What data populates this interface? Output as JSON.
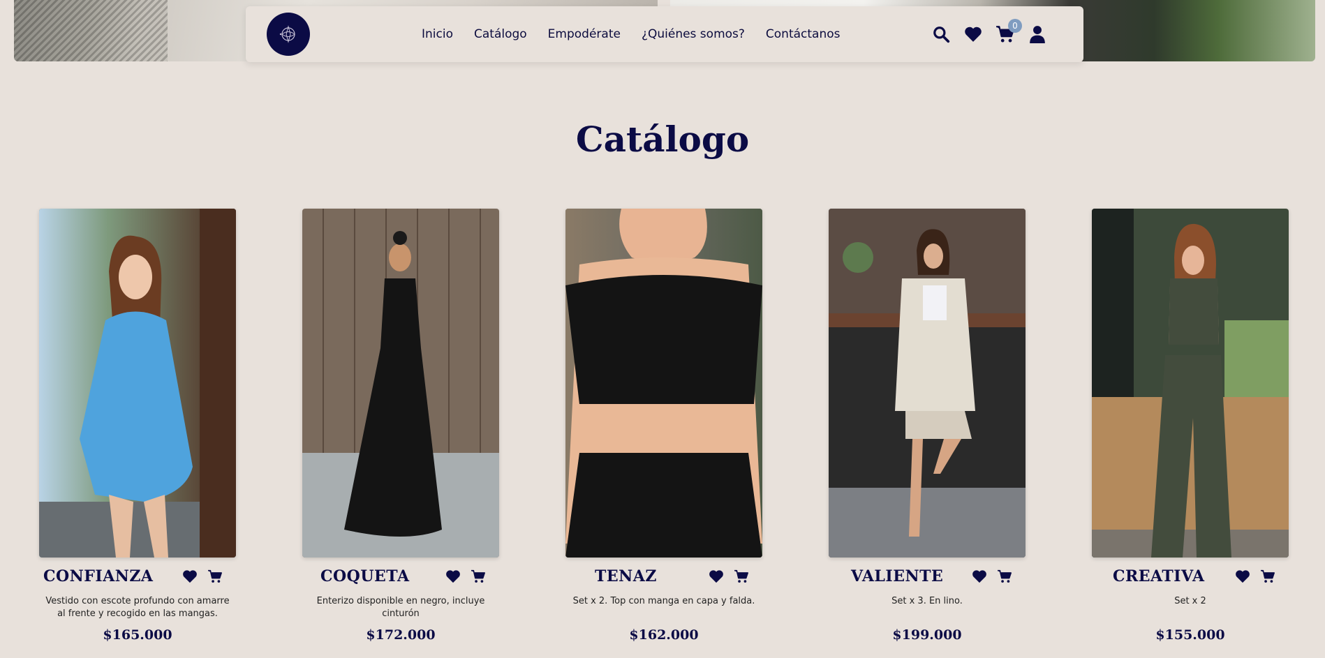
{
  "nav": {
    "links": [
      "Inicio",
      "Catálogo",
      "Empodérate",
      "¿Quiénes somos?",
      "Contáctanos"
    ],
    "cart_count": "0"
  },
  "icons": {
    "logo": "logo-icon",
    "search": "search-icon",
    "wishlist": "heart-icon",
    "cart": "cart-icon",
    "account": "user-icon"
  },
  "colors": {
    "brand_navy": "#0b0b45",
    "background": "#e8e1db",
    "badge": "#7f9cc0"
  },
  "section": {
    "title": "Catálogo"
  },
  "products": [
    {
      "name": "CONFIANZA",
      "description": "Vestido con escote profundo con amarre al frente y recogido en las mangas.",
      "price": "$165.000",
      "outfit_color": "#4fa3dd"
    },
    {
      "name": "COQUETA",
      "description": "Enterizo disponible en negro, incluye cinturón",
      "price": "$172.000",
      "outfit_color": "#141414"
    },
    {
      "name": "TENAZ",
      "description": "Set x 2. Top con manga en capa y falda.",
      "price": "$162.000",
      "outfit_color": "#141414"
    },
    {
      "name": "VALIENTE",
      "description": "Set x 3. En lino.",
      "price": "$199.000",
      "outfit_color": "#e3ddd1"
    },
    {
      "name": "CREATIVA",
      "description": "Set x 2",
      "price": "$155.000",
      "outfit_color": "#434c3d"
    }
  ]
}
